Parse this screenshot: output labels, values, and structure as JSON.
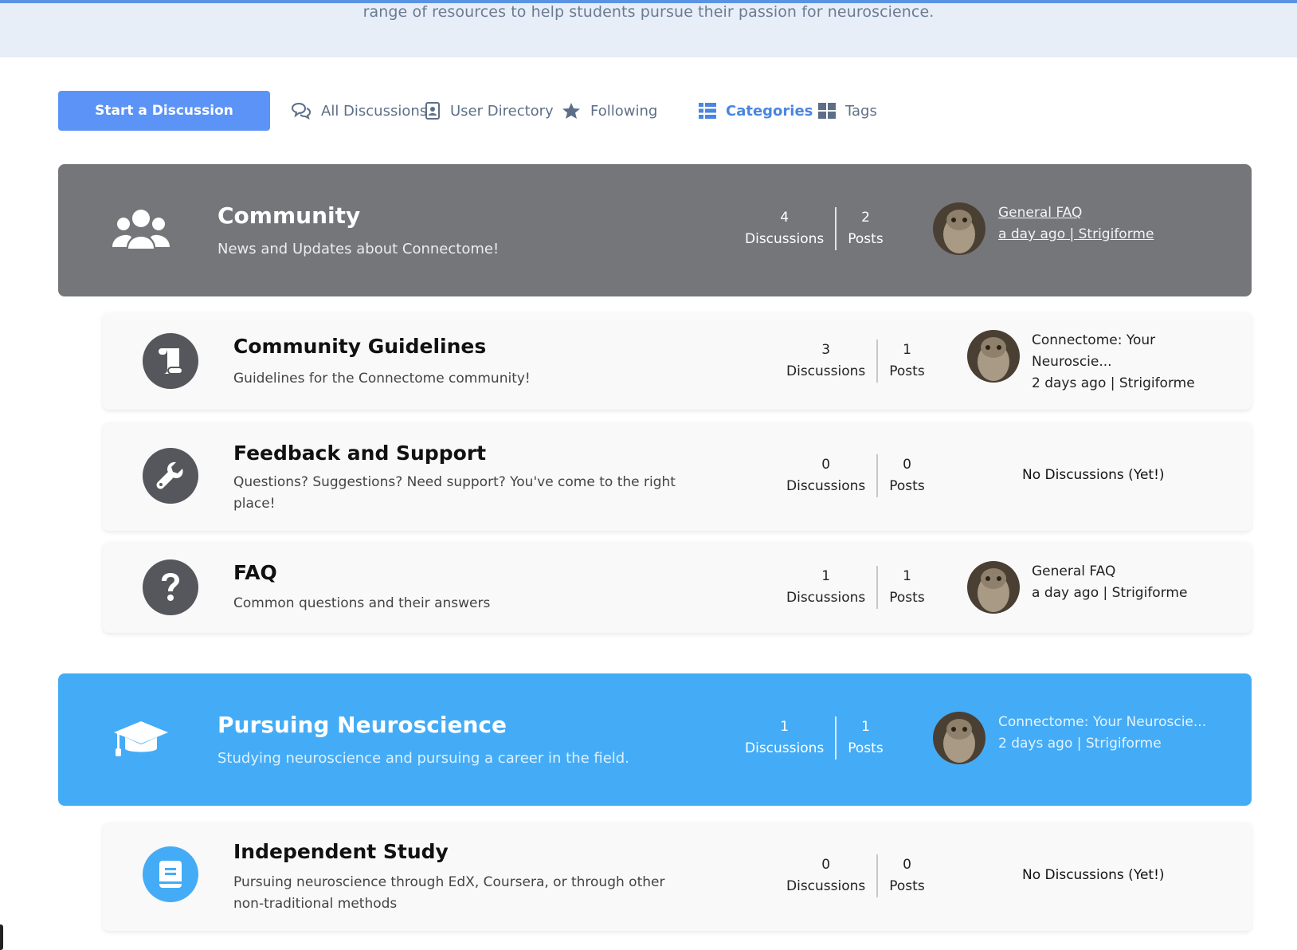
{
  "hero": {
    "text": "range of resources to help students pursue their passion for neuroscience."
  },
  "toolbar": {
    "start_label": "Start a Discussion",
    "nav": [
      {
        "label": "All Discussions",
        "icon": "chat-bubbles-icon"
      },
      {
        "label": "User Directory",
        "icon": "user-directory-icon"
      },
      {
        "label": "Following",
        "icon": "star-icon"
      },
      {
        "label": "Categories",
        "icon": "list-icon"
      },
      {
        "label": "Tags",
        "icon": "grid-icon"
      }
    ],
    "active": "Categories"
  },
  "colors": {
    "accent": "#5b93f7",
    "gray_category": "#75767a",
    "blue_category": "#44acf6",
    "icon_dark": "#56575c",
    "icon_blue": "#44acf6"
  },
  "stat_labels": {
    "discussions": "Discussions",
    "posts": "Posts"
  },
  "no_discussions": "No Discussions (Yet!)",
  "categories": {
    "community": {
      "title": "Community",
      "desc": "News and Updates about Connectome!",
      "icon": "users-icon",
      "discussions": "4",
      "posts": "2",
      "last_title": "General FAQ",
      "last_meta": "a day ago | Strigiforme"
    },
    "guidelines": {
      "title": "Community Guidelines",
      "desc": "Guidelines for the Connectome community!",
      "icon": "scroll-icon",
      "discussions": "3",
      "posts": "1",
      "last_title_1": "Connectome: Your",
      "last_title_2": "Neuroscie...",
      "last_meta": "2 days ago | Strigiforme"
    },
    "feedback": {
      "title": "Feedback and Support",
      "desc": "Questions? Suggestions? Need support? You've come to the right place!",
      "icon": "wrench-icon",
      "discussions": "0",
      "posts": "0"
    },
    "faq": {
      "title": "FAQ",
      "desc": "Common questions and their answers",
      "icon": "question-icon",
      "discussions": "1",
      "posts": "1",
      "last_title": "General FAQ",
      "last_meta": "a day ago | Strigiforme"
    },
    "pursuing": {
      "title": "Pursuing Neuroscience",
      "desc": "Studying neuroscience and pursuing a career in the field.",
      "icon": "graduation-cap-icon",
      "discussions": "1",
      "posts": "1",
      "last_title": "Connectome: Your Neuroscie...",
      "last_meta": "2 days ago | Strigiforme"
    },
    "independent": {
      "title": "Independent Study",
      "desc": "Pursuing neuroscience through EdX, Coursera, or through other non-traditional methods",
      "icon": "book-icon",
      "discussions": "0",
      "posts": "0"
    }
  }
}
